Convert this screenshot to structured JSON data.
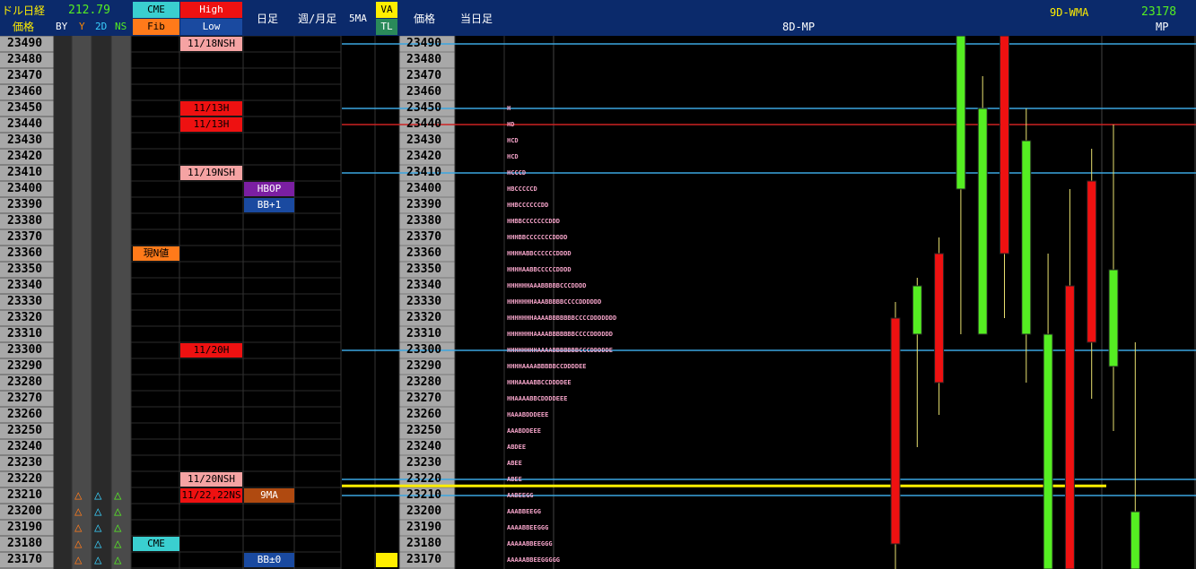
{
  "header": {
    "title": "ドル日経",
    "price_label": "価格",
    "ratio": "212.79",
    "cols": [
      "BY",
      "Y",
      "2D",
      "NS"
    ],
    "cme": "CME",
    "fib": "Fib",
    "high": "High",
    "low": "Low",
    "daily": "日足",
    "weekly_monthly": "週/月足",
    "ma5": "5MA",
    "va": "VA",
    "tl": "TL",
    "price_label2": "価格",
    "today": "当日足",
    "mp_title": "8D-MP",
    "wma_label": "9D-WMA",
    "wma_value": "23178",
    "mp_label": "MP"
  },
  "colors": {
    "up": "#55ee22",
    "down": "#ee1111",
    "price_col": "#a8a8a8",
    "header": "#0b2a6b",
    "tpo": "#f4a3c8",
    "hline": "#3aa6e0",
    "yellow_line": "#ffee00"
  },
  "markers": {
    "high_low": [
      {
        "price": 23490,
        "text": "11/18NSH",
        "style": "pink"
      },
      {
        "price": 23450,
        "text": "11/13H",
        "style": "red"
      },
      {
        "price": 23440,
        "text": "11/13H",
        "style": "red"
      },
      {
        "price": 23410,
        "text": "11/19NSH",
        "style": "pink"
      },
      {
        "price": 23300,
        "text": "11/20H",
        "style": "red"
      },
      {
        "price": 23220,
        "text": "11/20NSH",
        "style": "pink"
      },
      {
        "price": 23210,
        "text": "11/22,22NS",
        "style": "red"
      }
    ],
    "daily": [
      {
        "price": 23400,
        "text": "HBOP",
        "style": "purple"
      },
      {
        "price": 23390,
        "text": "BB+1",
        "style": "blue"
      },
      {
        "price": 23210,
        "text": "9MA",
        "style": "brown"
      },
      {
        "price": 23170,
        "text": "BB±0",
        "style": "blue"
      }
    ],
    "cme_col": [
      {
        "price": 23360,
        "text": "現N値",
        "style": "orange"
      },
      {
        "price": 23180,
        "text": "CME",
        "style": "cyan"
      }
    ],
    "triangles": [
      23210,
      23200,
      23190,
      23180,
      23170
    ]
  },
  "chart_data": {
    "type": "bar",
    "title": "8D-MP",
    "ylim": [
      23165,
      23495
    ],
    "price_ticks": [
      23490,
      23480,
      23470,
      23460,
      23450,
      23440,
      23430,
      23420,
      23410,
      23400,
      23390,
      23380,
      23370,
      23360,
      23350,
      23340,
      23330,
      23320,
      23310,
      23300,
      23290,
      23280,
      23270,
      23260,
      23250,
      23240,
      23230,
      23220,
      23210,
      23200,
      23190,
      23180,
      23170
    ],
    "tpo_profile": [
      {
        "price": 23450,
        "letters": "H"
      },
      {
        "price": 23440,
        "letters": "HD"
      },
      {
        "price": 23430,
        "letters": "HCD"
      },
      {
        "price": 23420,
        "letters": "HCD"
      },
      {
        "price": 23410,
        "letters": "HCCCD"
      },
      {
        "price": 23400,
        "letters": "HBCCCCCD"
      },
      {
        "price": 23390,
        "letters": "HHBCCCCCCDD"
      },
      {
        "price": 23380,
        "letters": "HHBBCCCCCCCDDD"
      },
      {
        "price": 23370,
        "letters": "HHHBBCCCCCCCDDDD"
      },
      {
        "price": 23360,
        "letters": "HHHHABBCCCCCCDDDD"
      },
      {
        "price": 23350,
        "letters": "HHHHAABBCCCCCDDDD"
      },
      {
        "price": 23340,
        "letters": "HHHHHHAAABBBBBCCCDDDD"
      },
      {
        "price": 23330,
        "letters": "HHHHHHHAAABBBBBCCCCDDDDDD"
      },
      {
        "price": 23320,
        "letters": "HHHHHHHAAAABBBBBBBCCCCDDDDDDD"
      },
      {
        "price": 23310,
        "letters": "HHHHHHHAAAABBBBBBBCCCCDDDDDD"
      },
      {
        "price": 23300,
        "letters": "HHHHHHHHAAAABBBBBBBCCCDDDDDE"
      },
      {
        "price": 23290,
        "letters": "HHHHAAAABBBBBCCDDDDEE"
      },
      {
        "price": 23280,
        "letters": "HHHAAAABBCCDDDDEE"
      },
      {
        "price": 23270,
        "letters": "HHAAAABBCDDDDEEE"
      },
      {
        "price": 23260,
        "letters": "HAAABDDDEEE"
      },
      {
        "price": 23250,
        "letters": "AAABDDEEE"
      },
      {
        "price": 23240,
        "letters": "ABDEE"
      },
      {
        "price": 23230,
        "letters": "ABEE"
      },
      {
        "price": 23220,
        "letters": "ABEE"
      },
      {
        "price": 23210,
        "letters": "AABEEGG"
      },
      {
        "price": 23200,
        "letters": "AAABBEEGG"
      },
      {
        "price": 23190,
        "letters": "AAAABBEEGGG"
      },
      {
        "price": 23180,
        "letters": "AAAAABBEEGGG"
      },
      {
        "price": 23170,
        "letters": "AAAAABBEEGGGGG"
      }
    ],
    "hlines": [
      {
        "price": 23490,
        "color": "#3aa6e0"
      },
      {
        "price": 23450,
        "color": "#3aa6e0"
      },
      {
        "price": 23440,
        "color": "#cc2222"
      },
      {
        "price": 23410,
        "color": "#3aa6e0"
      },
      {
        "price": 23300,
        "color": "#3aa6e0"
      },
      {
        "price": 23220,
        "color": "#3aa6e0"
      },
      {
        "price": 23216,
        "color": "#ffee00"
      },
      {
        "price": 23210,
        "color": "#3aa6e0"
      }
    ],
    "candles": [
      {
        "dir": "down",
        "high": 23330,
        "open": 23320,
        "close": 23180,
        "low": 23160
      },
      {
        "dir": "up",
        "high": 23345,
        "open": 23310,
        "close": 23340,
        "low": 23240
      },
      {
        "dir": "down",
        "high": 23370,
        "open": 23360,
        "close": 23280,
        "low": 23260
      },
      {
        "dir": "up",
        "high": 23540,
        "open": 23400,
        "close": 23530,
        "low": 23310
      },
      {
        "dir": "up",
        "high": 23470,
        "open": 23310,
        "close": 23450,
        "low": 23310
      },
      {
        "dir": "down",
        "high": 23520,
        "open": 23510,
        "close": 23360,
        "low": 23320
      },
      {
        "dir": "up",
        "high": 23450,
        "open": 23310,
        "close": 23430,
        "low": 23280
      },
      {
        "dir": "up",
        "high": 23360,
        "open": 23160,
        "close": 23310,
        "low": 23120
      },
      {
        "dir": "down",
        "high": 23400,
        "open": 23340,
        "close": 23160,
        "low": 23150
      },
      {
        "dir": "down",
        "high": 23425,
        "open": 23405,
        "close": 23305,
        "low": 23270
      },
      {
        "dir": "up",
        "high": 23440,
        "open": 23290,
        "close": 23350,
        "low": 23250
      },
      {
        "dir": "up",
        "high": 23305,
        "open": 23150,
        "close": 23200,
        "low": 23100
      }
    ]
  }
}
